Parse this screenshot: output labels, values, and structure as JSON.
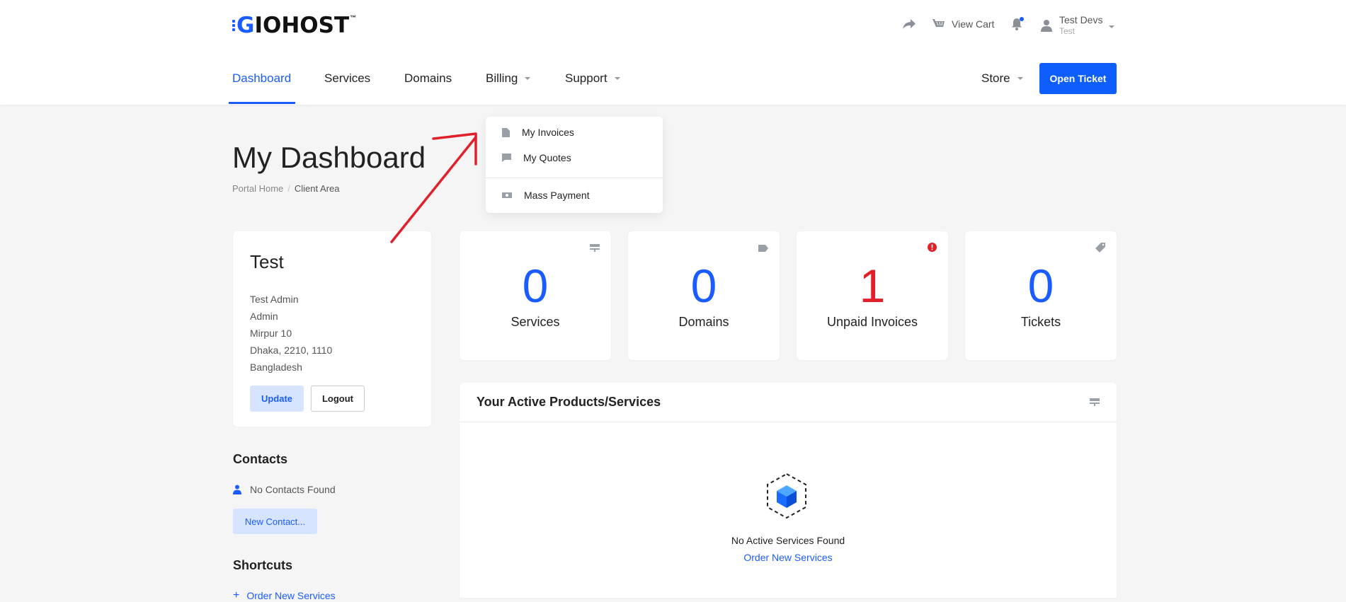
{
  "brand": {
    "logo_text_g": "G",
    "logo_text_rest": "IOHOST",
    "logo_tm": "™"
  },
  "header": {
    "view_cart": "View Cart",
    "user_name": "Test Devs",
    "user_sub": "Test"
  },
  "nav": {
    "items": [
      {
        "label": "Dashboard",
        "active": true
      },
      {
        "label": "Services"
      },
      {
        "label": "Domains"
      },
      {
        "label": "Billing"
      },
      {
        "label": "Support"
      }
    ],
    "store": "Store",
    "open_ticket": "Open Ticket"
  },
  "billing_menu": {
    "items": [
      {
        "label": "My Invoices",
        "icon": "document-icon"
      },
      {
        "label": "My Quotes",
        "icon": "comment-icon"
      },
      {
        "label": "Mass Payment",
        "icon": "money-icon"
      }
    ]
  },
  "page": {
    "title": "My Dashboard",
    "breadcrumb": [
      "Portal Home",
      "/",
      "Client Area"
    ]
  },
  "profile": {
    "name": "Test",
    "lines": [
      "Test Admin",
      "Admin",
      "Mirpur 10",
      "Dhaka, 2210, 1110",
      "Bangladesh"
    ],
    "update": "Update",
    "logout": "Logout"
  },
  "contacts": {
    "heading": "Contacts",
    "empty": "No Contacts Found",
    "new_button": "New Contact..."
  },
  "shortcuts": {
    "heading": "Shortcuts",
    "first": "Order New Services"
  },
  "stats": [
    {
      "value": "0",
      "label": "Services",
      "icon": "server-icon"
    },
    {
      "value": "0",
      "label": "Domains",
      "icon": "tag-icon"
    },
    {
      "value": "1",
      "label": "Unpaid Invoices",
      "icon": "alert-icon",
      "color": "#e1202a"
    },
    {
      "value": "0",
      "label": "Tickets",
      "icon": "ticket-icon"
    }
  ],
  "products": {
    "heading": "Your Active Products/Services",
    "empty": "No Active Services Found",
    "order_link": "Order New Services"
  },
  "colors": {
    "accent": "#1a5cff",
    "danger": "#e1202a",
    "annotation": "#e0202a"
  }
}
